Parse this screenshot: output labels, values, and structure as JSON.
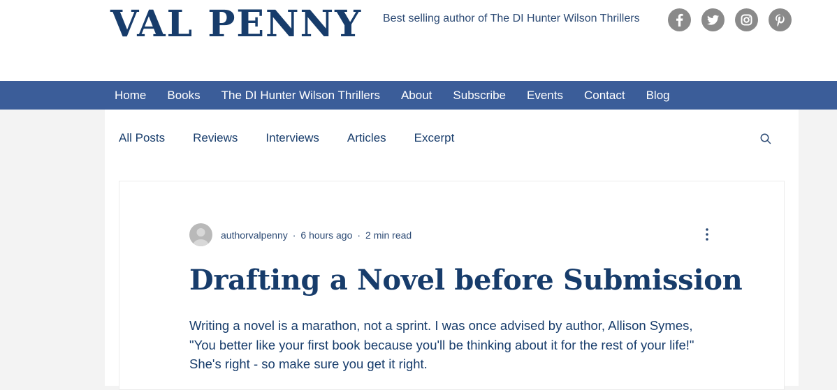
{
  "site": {
    "name": "VAL PENNY",
    "tagline": "Best selling author of The DI Hunter Wilson Thrillers",
    "social_icons": [
      "facebook-icon",
      "twitter-icon",
      "instagram-icon",
      "pinterest-icon"
    ]
  },
  "nav": {
    "items": [
      "Home",
      "Books",
      "The DI Hunter Wilson Thrillers",
      "About",
      "Subscribe",
      "Events",
      "Contact",
      "Blog"
    ]
  },
  "blog": {
    "categories": [
      "All Posts",
      "Reviews",
      "Interviews",
      "Articles",
      "Excerpt"
    ],
    "post": {
      "author": "authorvalpenny",
      "time_ago": "6 hours ago",
      "read_time": "2 min read",
      "title": "Drafting a Novel before Submission",
      "excerpt": "Writing a novel is a marathon, not a sprint. I was once advised by author, Allison Symes, \"You better like your first book because you'll be thinking about it for the rest of your life!\" She's right - so make sure you get it right."
    }
  },
  "colors": {
    "brand_navy": "#173c6b",
    "nav_blue": "#3b5d99",
    "social_gray": "#8a8a8a"
  }
}
